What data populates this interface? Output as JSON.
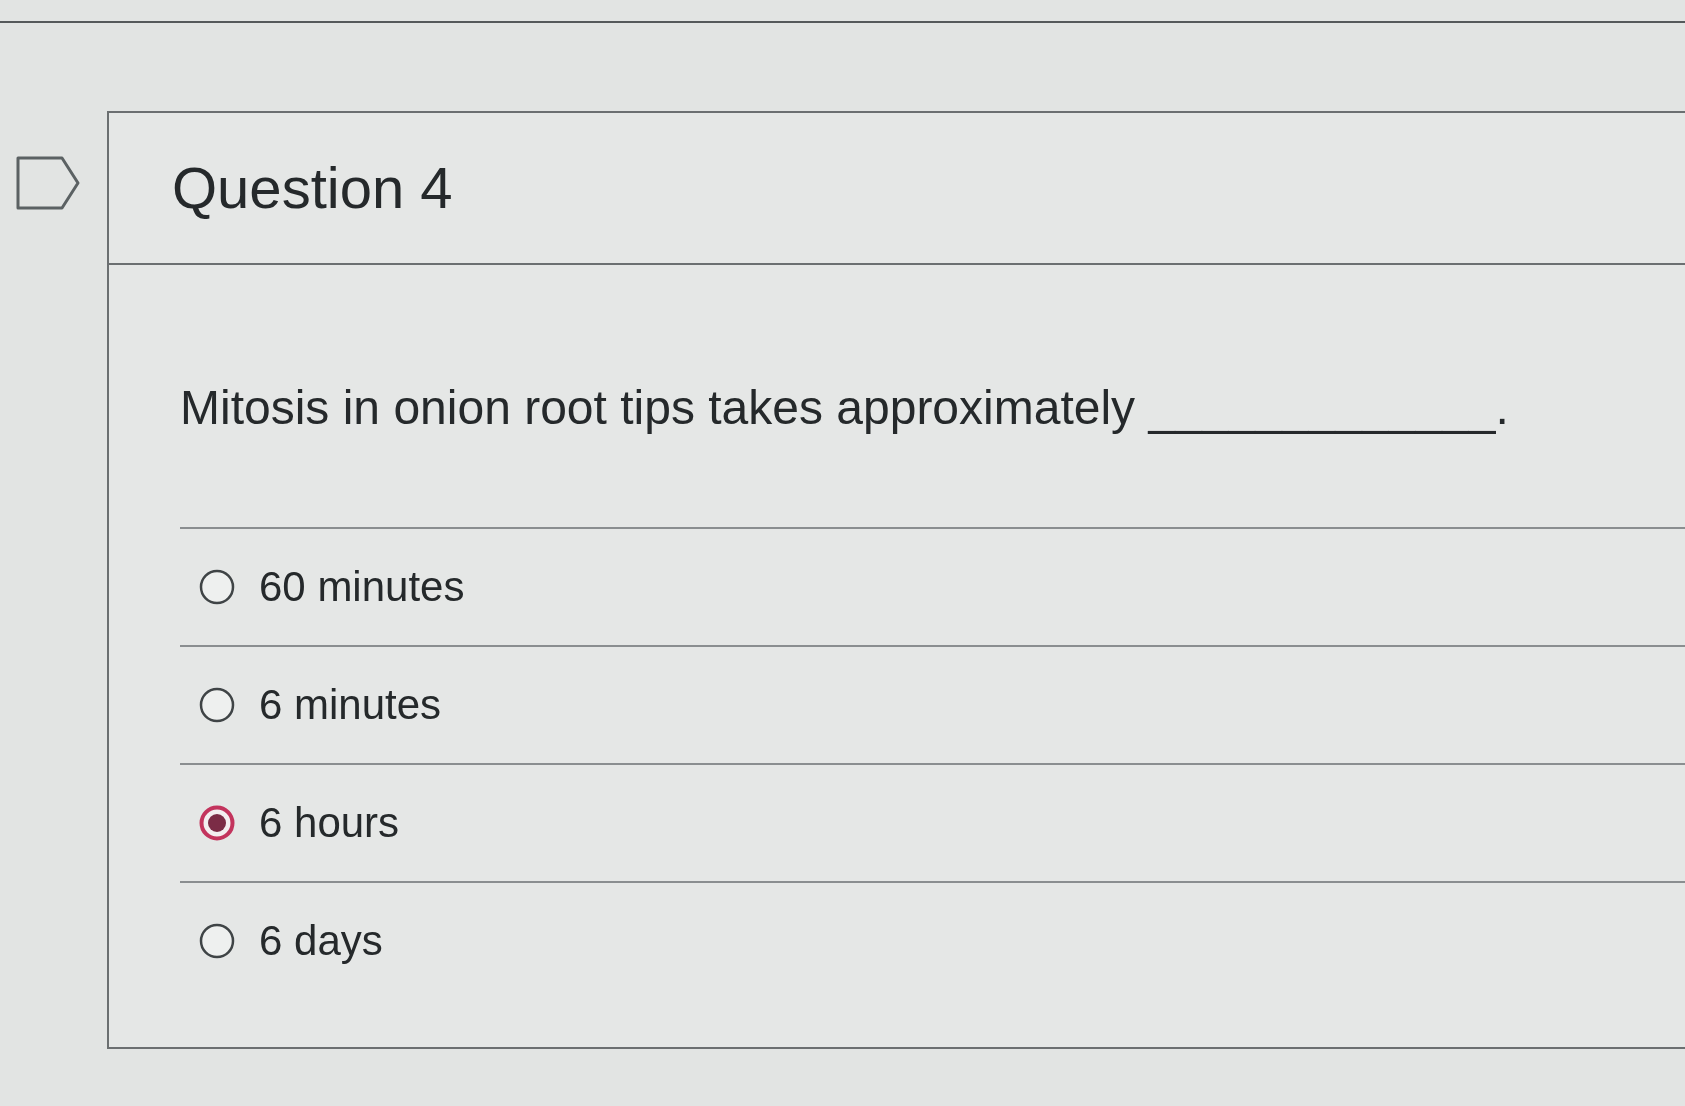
{
  "flag_button": {
    "flagged": false
  },
  "question": {
    "title": "Question 4",
    "text": "Mitosis in onion root tips takes approximately _____________.",
    "answers": [
      {
        "label": "60 minutes",
        "selected": false
      },
      {
        "label": "6 minutes",
        "selected": false
      },
      {
        "label": "6 hours",
        "selected": true
      },
      {
        "label": "6 days",
        "selected": false
      }
    ]
  }
}
